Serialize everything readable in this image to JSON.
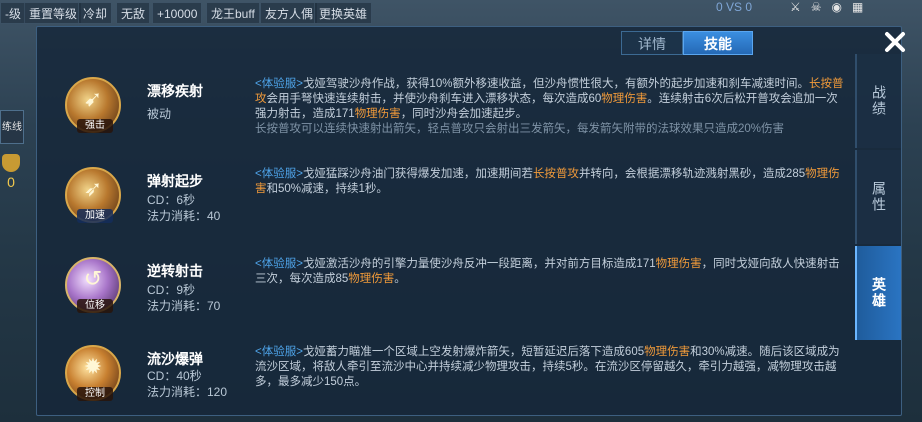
{
  "bg": {
    "buttons": [
      "-级",
      "重置等级",
      "冷却",
      "无敌",
      "+10000",
      "龙王buff",
      "友方人偶",
      "更换英雄"
    ],
    "score": "0 VS 0",
    "side_label": "练线",
    "gold": "0"
  },
  "tabs": [
    {
      "label": "详情"
    },
    {
      "label": "技能"
    }
  ],
  "sidenav": [
    "战绩",
    "属性",
    "英雄"
  ],
  "skills": [
    {
      "name": "漂移疾射",
      "tag": "强击",
      "sub1": "被动",
      "sub2": "",
      "desc": {
        "p1": "<体验服>",
        "p2": "戈娅驾驶沙舟作战，获得10%额外移速收益，但沙舟惯性很大，有额外的起步加速和刹车减速时间。",
        "p3": "长按普攻",
        "p4": "会用手弩快速连续射击，并使沙舟刹车进入漂移状态，每次造成60",
        "p5": "物理伤害",
        "p6": "。连续射击6次后松开普攻会追加一次强力射击，造成171",
        "p7": "物理伤害",
        "p8": "，同时沙舟会加速起步。",
        "p9": "长按普攻可以连续快速射出箭矢，轻点普攻只会射出三发箭矢，每发箭矢附带的法球效果只造成20%伤害"
      }
    },
    {
      "name": "弹射起步",
      "tag": "加速",
      "sub1": "CD：6秒",
      "sub2": "法力消耗：40",
      "desc": {
        "p1": "<体验服>",
        "p2": "戈娅猛踩沙舟油门获得爆发加速，加速期间若",
        "p3": "长按普攻",
        "p4": "并转向，会根据漂移轨迹溅射黑砂，造成285",
        "p5": "物理伤害",
        "p6": "和50%减速，持续1秒。"
      }
    },
    {
      "name": "逆转射击",
      "tag": "位移",
      "sub1": "CD：9秒",
      "sub2": "法力消耗：70",
      "desc": {
        "p1": "<体验服>",
        "p2": "戈娅激活沙舟的引擎力量使沙舟反冲一段距离，并对前方目标造成171",
        "p3": "物理伤害",
        "p4": "，同时戈娅向敌人快速射击三次，每次造成85",
        "p5": "物理伤害",
        "p6": "。"
      }
    },
    {
      "name": "流沙爆弹",
      "tag": "控制",
      "sub1": "CD：40秒",
      "sub2": "法力消耗：120",
      "desc": {
        "p1": "<体验服>",
        "p2": "戈娅蓄力瞄准一个区域上空发射爆炸箭矢，短暂延迟后落下造成605",
        "p3": "物理伤害",
        "p4": "和30%减速。随后该区域成为流沙区域，将敌人牵引至流沙中心并持续减少物理攻击，持续5秒。在流沙区停留越久，牵引力越强，减物理攻击越多，最多减少150点。"
      }
    }
  ]
}
